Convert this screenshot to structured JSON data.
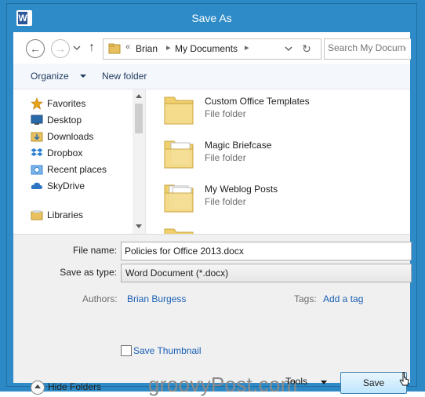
{
  "window": {
    "title": "Save As",
    "app_icon_letter": "W"
  },
  "nav": {
    "address": {
      "overflow": "«",
      "crumbs": [
        "Brian",
        "My Documents"
      ]
    },
    "search_placeholder": "Search My Documents"
  },
  "toolbar": {
    "organize_label": "Organize",
    "new_folder_label": "New folder"
  },
  "sidebar": {
    "items": [
      {
        "label": "Favorites",
        "icon": "star-icon",
        "color": "#e8a317"
      },
      {
        "label": "Desktop",
        "icon": "desktop-icon",
        "color": "#2b6aa8"
      },
      {
        "label": "Downloads",
        "icon": "downloads-folder-icon",
        "color": "#e8c060"
      },
      {
        "label": "Dropbox",
        "icon": "dropbox-icon",
        "color": "#2c7fd1"
      },
      {
        "label": "Recent places",
        "icon": "recent-places-icon",
        "color": "#3b8bd6"
      },
      {
        "label": "SkyDrive",
        "icon": "skydrive-cloud-icon",
        "color": "#2e73c4"
      },
      {
        "label": "Libraries",
        "icon": "libraries-icon",
        "color": "#e8c060"
      }
    ]
  },
  "files": [
    {
      "name": "Custom Office Templates",
      "type": "File folder"
    },
    {
      "name": "Magic Briefcase",
      "type": "File folder"
    },
    {
      "name": "My Weblog Posts",
      "type": "File folder"
    }
  ],
  "form": {
    "file_name_label": "File name:",
    "file_name_value": "Policies for Office 2013.docx",
    "save_as_type_label": "Save as type:",
    "save_as_type_value": "Word Document (*.docx)",
    "authors_label": "Authors:",
    "authors_value": "Brian Burgess",
    "tags_label": "Tags:",
    "tags_value": "Add a tag",
    "save_thumbnail_label": "Save Thumbnail"
  },
  "footer": {
    "hide_folders_label": "Hide Folders",
    "tools_label": "Tools",
    "save_label": "Save",
    "watermark": "groovyPost.com"
  },
  "colors": {
    "window_frame": "#2e8bc8",
    "link_blue": "#1a5fb4",
    "folder_yellow": "#e8c060"
  }
}
